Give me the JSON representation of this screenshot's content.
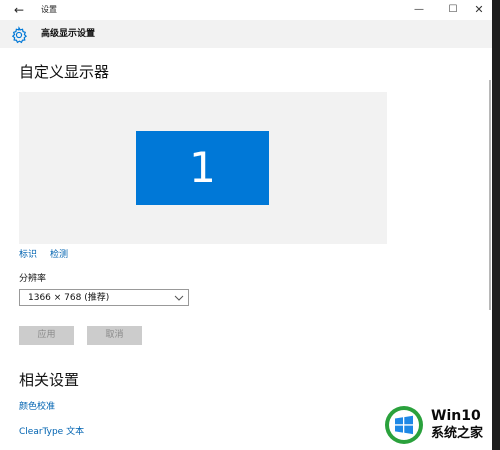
{
  "window": {
    "title": "设置",
    "back_glyph": "←",
    "minimize_glyph": "—",
    "maximize_glyph": "☐",
    "close_glyph": "✕"
  },
  "header": {
    "title": "高级显示设置",
    "icon": "gear-icon"
  },
  "custom_display": {
    "title": "自定义显示器",
    "monitor_number": "1",
    "identify_link": "标识",
    "detect_link": "检测"
  },
  "resolution": {
    "label": "分辨率",
    "selected": "1366 × 768 (推荐)"
  },
  "buttons": {
    "apply": "应用",
    "cancel": "取消"
  },
  "related": {
    "title": "相关设置",
    "color_calibration": "颜色校准",
    "cleartype": "ClearType 文本"
  },
  "watermark": {
    "line1": "Win10",
    "line2": "系统之家"
  },
  "colors": {
    "accent": "#0078d7",
    "link": "#0063b1",
    "disabled_button": "#cccccc"
  }
}
